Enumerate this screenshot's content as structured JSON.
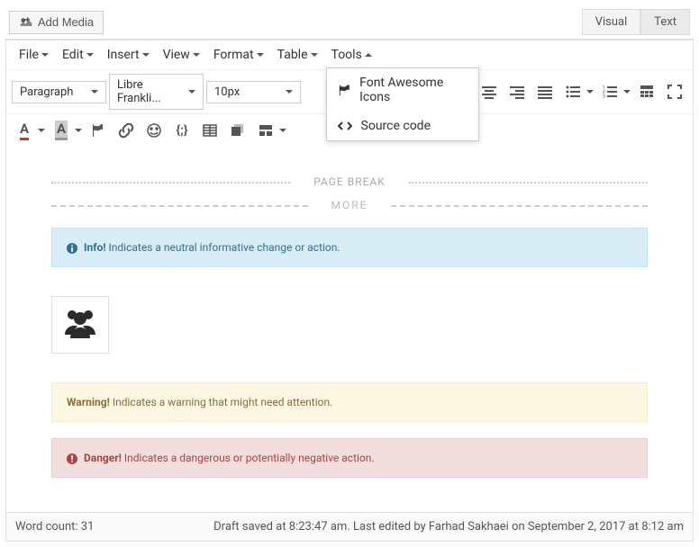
{
  "topbar": {
    "add_media": "Add Media",
    "tabs": {
      "visual": "Visual",
      "text": "Text"
    }
  },
  "menubar": {
    "file": "File",
    "edit": "Edit",
    "insert": "Insert",
    "view": "View",
    "format": "Format",
    "table": "Table",
    "tools": "Tools"
  },
  "tools_menu": {
    "fa_icons": "Font Awesome Icons",
    "source_code": "Source code"
  },
  "toolbar1": {
    "style": "Paragraph",
    "font": "Libre Frankli...",
    "size": "10px"
  },
  "content": {
    "page_break": "PAGE BREAK",
    "more": "MORE",
    "info_label": "Info!",
    "info_text": " Indicates a neutral informative change or action.",
    "warning_label": "Warning!",
    "warning_text": " Indicates a warning that might need attention.",
    "danger_label": "Danger!",
    "danger_text": " Indicates a dangerous or potentially negative action."
  },
  "status": {
    "word_count": "Word count: 31",
    "save_info": "Draft saved at 8:23:47 am. Last edited by Farhad Sakhaei on September 2, 2017 at 8:12 am"
  }
}
